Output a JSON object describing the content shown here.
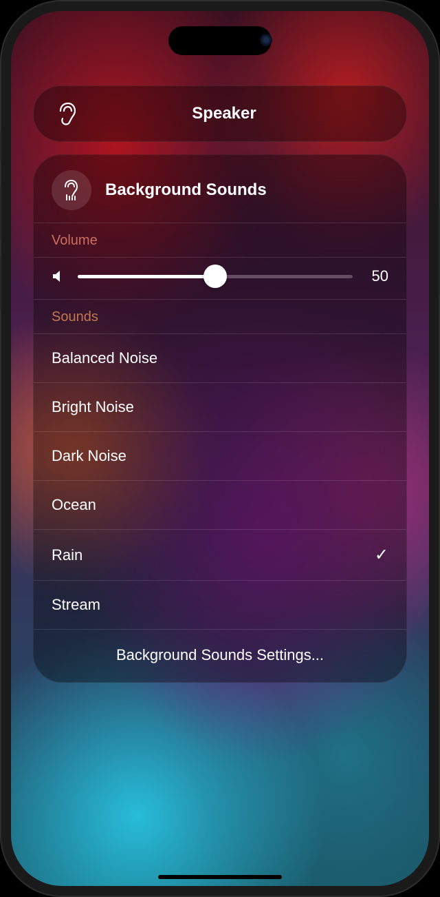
{
  "speaker": {
    "label": "Speaker",
    "icon": "ear-icon"
  },
  "panel": {
    "title": "Background Sounds",
    "icon": "ear-waves-icon",
    "volume_label": "Volume",
    "volume_value": "50",
    "volume_percent": 50,
    "sounds_label": "Sounds",
    "sounds": [
      {
        "name": "Balanced Noise",
        "selected": false
      },
      {
        "name": "Bright Noise",
        "selected": false
      },
      {
        "name": "Dark Noise",
        "selected": false
      },
      {
        "name": "Ocean",
        "selected": false
      },
      {
        "name": "Rain",
        "selected": true
      },
      {
        "name": "Stream",
        "selected": false
      }
    ],
    "settings_link": "Background Sounds Settings..."
  }
}
